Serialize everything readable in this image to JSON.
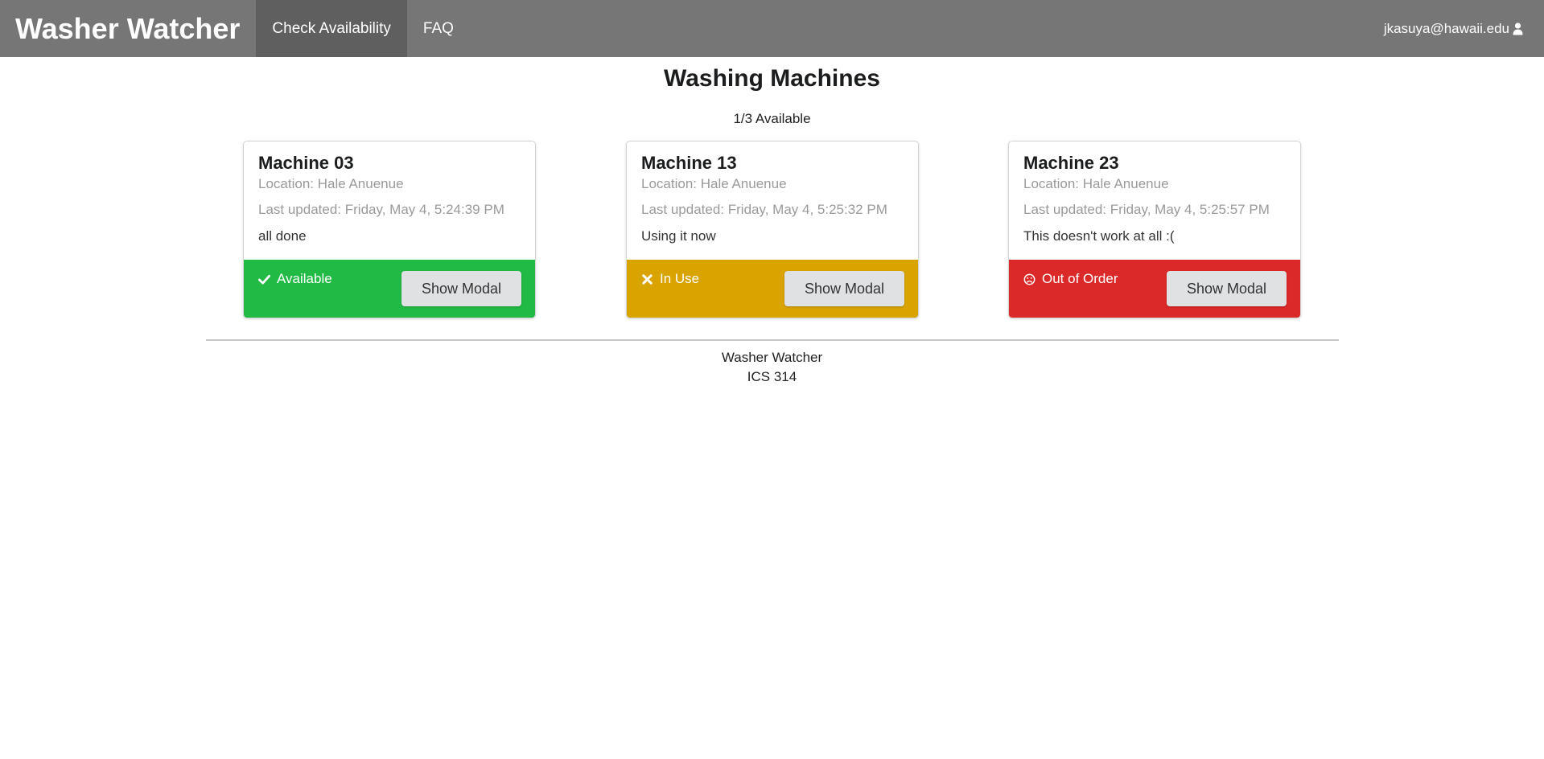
{
  "navbar": {
    "brand": "Washer Watcher",
    "items": [
      {
        "label": "Check Availability",
        "active": true
      },
      {
        "label": "FAQ",
        "active": false
      }
    ],
    "user_email": "jkasuya@hawaii.edu",
    "user_icon": "user-icon",
    "background_color": "#767676",
    "active_item_color": "#5f5f5f"
  },
  "main": {
    "title": "Washing Machines",
    "available_count": "1/3 Available"
  },
  "machines": [
    {
      "name": "Machine 03",
      "location": "Location: Hale Anuenue",
      "last_updated": "Last updated: Friday, May 4, 5:24:39 PM",
      "description": "all done",
      "status": "Available",
      "status_icon": "check-icon",
      "status_color": "#21ba45",
      "button_label": "Show Modal"
    },
    {
      "name": "Machine 13",
      "location": "Location: Hale Anuenue",
      "last_updated": "Last updated: Friday, May 4, 5:25:32 PM",
      "description": "Using it now",
      "status": "In Use",
      "status_icon": "x-icon",
      "status_color": "#d9a300",
      "button_label": "Show Modal"
    },
    {
      "name": "Machine 23",
      "location": "Location: Hale Anuenue",
      "last_updated": "Last updated: Friday, May 4, 5:25:57 PM",
      "description": "This doesn't work at all :(",
      "status": "Out of Order",
      "status_icon": "frown-icon",
      "status_color": "#db2828",
      "button_label": "Show Modal"
    }
  ],
  "footer": {
    "line1": "Washer Watcher",
    "line2": "ICS 314"
  }
}
